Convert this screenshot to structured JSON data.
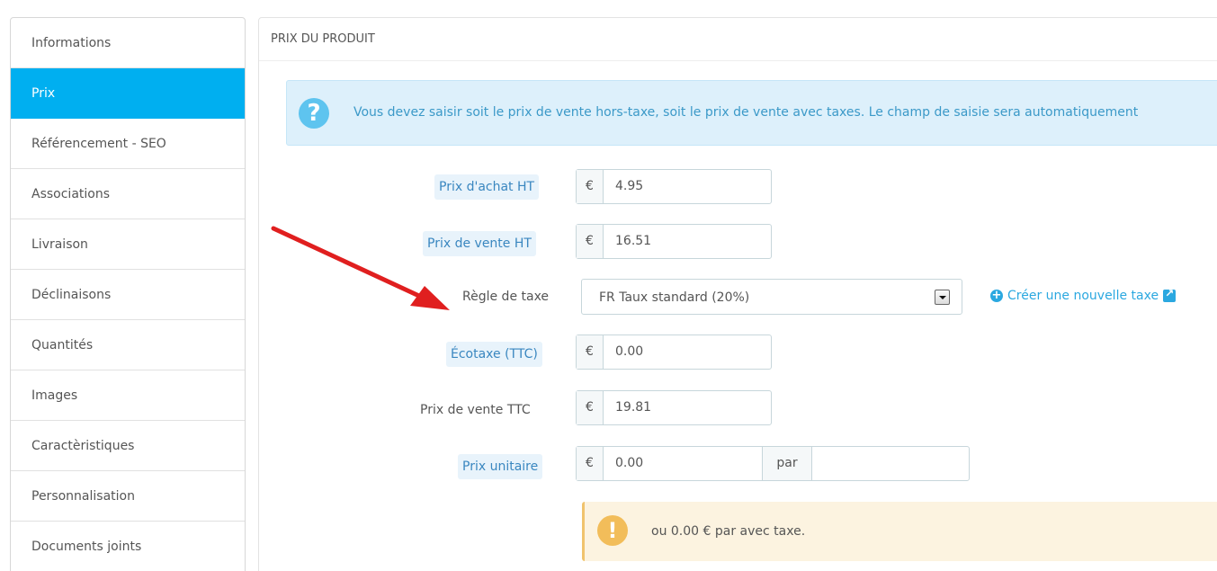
{
  "sidebar": {
    "items": [
      {
        "label": "Informations"
      },
      {
        "label": "Prix"
      },
      {
        "label": "Référencement - SEO"
      },
      {
        "label": "Associations"
      },
      {
        "label": "Livraison"
      },
      {
        "label": "Déclinaisons"
      },
      {
        "label": "Quantités"
      },
      {
        "label": "Images"
      },
      {
        "label": "Caractèristiques"
      },
      {
        "label": "Personnalisation"
      },
      {
        "label": "Documents joints"
      }
    ],
    "active_index": 1
  },
  "panel": {
    "title": "PRIX DU PRODUIT",
    "info_text": "Vous devez saisir soit le prix de vente hors-taxe, soit le prix de vente avec taxes. Le champ de saisie sera automatiquement",
    "info_icon": "question-icon"
  },
  "form": {
    "purchase_price": {
      "label": "Prix d'achat HT",
      "currency": "€",
      "value": "4.95"
    },
    "sale_price_ht": {
      "label": "Prix de vente HT",
      "currency": "€",
      "value": "16.51"
    },
    "tax_rule": {
      "label": "Règle de taxe",
      "value": "FR Taux standard (20%)"
    },
    "create_tax_link": "Créer une nouvelle taxe",
    "ecotax": {
      "label": "Écotaxe (TTC)",
      "currency": "€",
      "value": "0.00"
    },
    "sale_price_ttc": {
      "label": "Prix de vente TTC",
      "currency": "€",
      "value": "19.81"
    },
    "unit_price": {
      "label": "Prix unitaire",
      "currency": "€",
      "value": "0.00",
      "per_label": "par",
      "per_value": ""
    },
    "warning_text": "ou 0.00 € par avec taxe."
  },
  "colors": {
    "accent": "#00aff0",
    "arrow": "#e01f1f",
    "info_bg": "#ddf0fb",
    "warn_bg": "#fcf3e0"
  }
}
